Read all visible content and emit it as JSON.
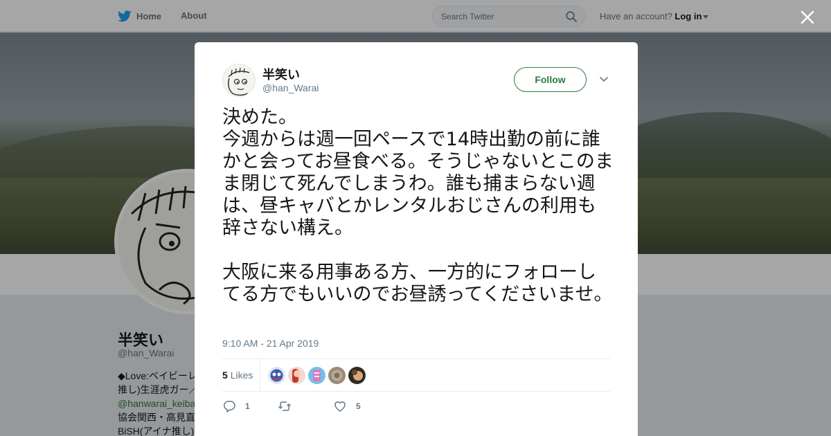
{
  "nav": {
    "home_label": "Home",
    "about_label": "About",
    "search_placeholder": "Search Twitter",
    "account_prompt": "Have an account?",
    "login_label": "Log in"
  },
  "profile": {
    "name": "半笑い",
    "handle": "@han_Warai",
    "bio_lines": [
      "◆Love:ベイビーレ",
      "推し)生涯虎ガー／",
      "@hanwarai_keiba",
      "協会関西・高見直",
      "BiSH(アイナ推し)"
    ]
  },
  "tweet": {
    "author_name": "半笑い",
    "author_handle": "@han_Warai",
    "follow_label": "Follow",
    "text": "決めた。\n今週からは週一回ペースで14時出勤の前に誰かと会ってお昼食べる。そうじゃないとこのまま閉じて死んでしまうわ。誰も捕まらない週は、昼キャバとかレンタルおじさんの利用も辞さない構え。\n\n大阪に来る用事ある方、一方的にフォローしてる方でもいいのでお昼誘ってくださいませ。",
    "timestamp": "9:10 AM - 21 Apr 2019",
    "likes_count": "5",
    "likes_label": "Likes",
    "reply_count": "1",
    "retweet_count": "",
    "like_count": "5"
  },
  "colors": {
    "accent": "#2d7a3e",
    "twitter_blue": "#1da1f2",
    "muted": "#657786"
  }
}
